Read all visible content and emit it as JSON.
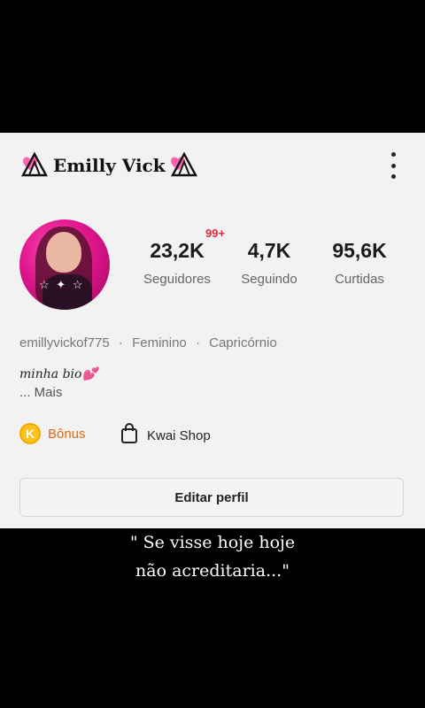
{
  "profile": {
    "display_name": "Emilly Vick",
    "handle": "emillyvickof775",
    "gender": "Feminino",
    "sign": "Capricórnio",
    "separator": "·",
    "bio": "minha bio💕",
    "more": "... Mais",
    "notification_badge": "99+"
  },
  "stats": [
    {
      "value": "23,2K",
      "label": "Seguidores"
    },
    {
      "value": "4,7K",
      "label": "Seguindo"
    },
    {
      "value": "95,6K",
      "label": "Curtidas"
    }
  ],
  "actions": {
    "bonus_label": "Bônus",
    "bonus_icon_letter": "K",
    "shop_label": "Kwai Shop",
    "edit_label": "Editar perfil"
  },
  "caption": {
    "line1": "\" Se visse hoje hoje",
    "line2": "não acreditaria...\""
  },
  "colors": {
    "accent_orange": "#e06a14",
    "badge_red": "#e0283b",
    "coin_yellow": "#ffc21a",
    "avatar_pink": "#e0158c"
  }
}
